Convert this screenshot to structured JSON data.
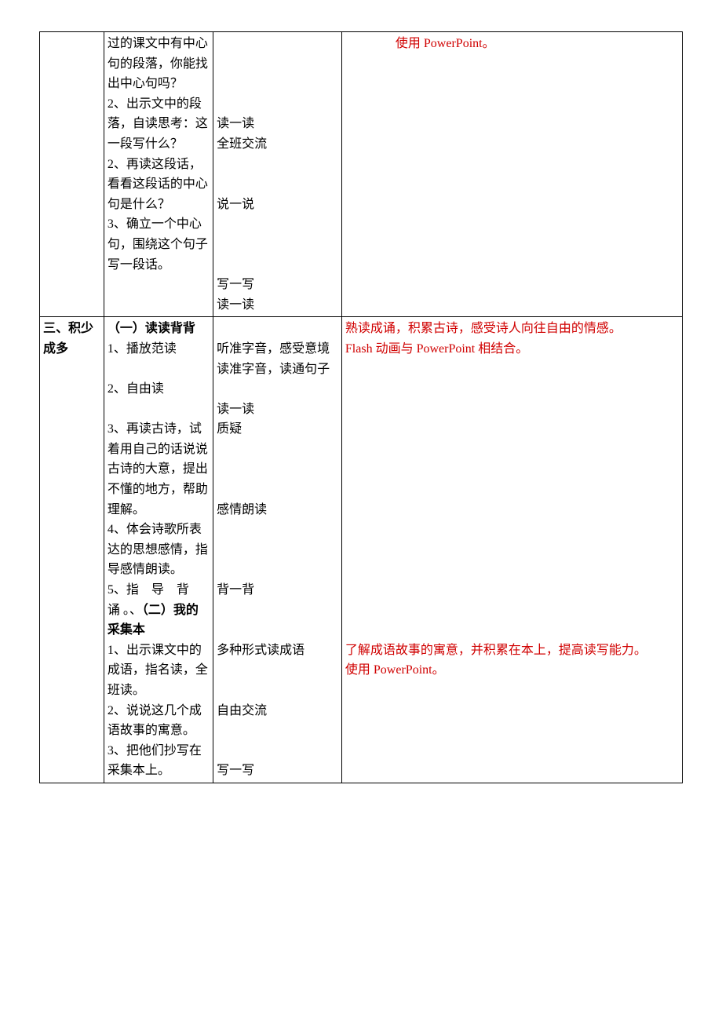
{
  "rows": [
    {
      "c1": "",
      "c2_parts": [
        {
          "text": "过的课文中有中心句的段落，你能找出中心句吗？",
          "bold": false
        },
        {
          "text": "2、出示文中的段落，自读思考：这一段写什么？",
          "bold": false
        },
        {
          "text": "2、再读这段话，看看这段话的中心句是什么？",
          "bold": false
        },
        {
          "text": "3、确立一个中心句，围绕这个句子写一段话。",
          "bold": false
        }
      ],
      "c3_parts": [
        {
          "text": "",
          "blankLines": 4
        },
        {
          "text": "读一读"
        },
        {
          "text": "全班交流"
        },
        {
          "text": "",
          "blankLines": 2
        },
        {
          "text": "说一说"
        },
        {
          "text": "",
          "blankLines": 3
        },
        {
          "text": "写一写"
        },
        {
          "text": "读一读"
        }
      ],
      "c4_parts": [
        {
          "text": "使用 PowerPoint。",
          "red": true,
          "indent": true
        }
      ]
    },
    {
      "c1": "三、积少成多",
      "c1_bold": true,
      "c2_parts": [
        {
          "text": "（一）读读背背",
          "bold": true
        },
        {
          "text": "1、播放范读",
          "bold": false
        },
        {
          "text": "",
          "blankLines": 1
        },
        {
          "text": "2、自由读",
          "bold": false
        },
        {
          "text": "",
          "blankLines": 1
        },
        {
          "text": "3、再读古诗，试着用自己的话说说古诗的大意，提出不懂的地方，帮助理解。",
          "bold": false
        },
        {
          "text": "4、体会诗歌所表达的思想感情，指导感情朗读。",
          "bold": false
        },
        {
          "text": "5、指 导 背 诵 。、（二）我的采集本",
          "bold": true,
          "mixed": true
        },
        {
          "text": "1、出示课文中的成语，指名读，全班读。",
          "bold": false
        },
        {
          "text": "2、说说这几个成语故事的寓意。",
          "bold": false
        },
        {
          "text": "3、把他们抄写在采集本上。",
          "bold": false
        }
      ],
      "c3_parts": [
        {
          "text": "",
          "blankLines": 1
        },
        {
          "text": "听准字音，感受意境"
        },
        {
          "text": "读准字音，读通句子"
        },
        {
          "text": "",
          "blankLines": 1
        },
        {
          "text": "读一读"
        },
        {
          "text": "质疑"
        },
        {
          "text": "",
          "blankLines": 3
        },
        {
          "text": "感情朗读"
        },
        {
          "text": "",
          "blankLines": 3
        },
        {
          "text": "背一背"
        },
        {
          "text": "",
          "blankLines": 2
        },
        {
          "text": "多种形式读成语"
        },
        {
          "text": "",
          "blankLines": 2
        },
        {
          "text": "自由交流"
        },
        {
          "text": "",
          "blankLines": 2
        },
        {
          "text": "写一写"
        }
      ],
      "c4_parts": [
        {
          "text": "熟读成诵，积累古诗，感受诗人向往自由的情感。",
          "red": true
        },
        {
          "text": "Flash 动画与 PowerPoint 相结合。",
          "red": true
        },
        {
          "text": "",
          "blankLines": 14
        },
        {
          "text": "了解成语故事的寓意，并积累在本上，提高读写能力。",
          "red": true
        },
        {
          "text": "使用 PowerPoint。",
          "red": true
        }
      ]
    }
  ]
}
